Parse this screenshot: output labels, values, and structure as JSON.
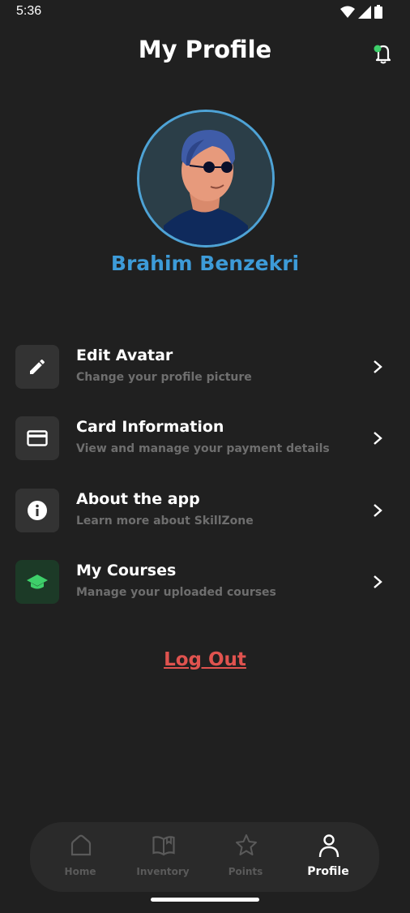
{
  "status_bar": {
    "time": "5:36"
  },
  "header": {
    "title": "My Profile",
    "bell_icon": "notification-bell-icon",
    "notification_dot_color": "#3ecf6a"
  },
  "profile": {
    "name": "Brahim Benzekri",
    "name_color": "#3d9bd8"
  },
  "menu": [
    {
      "icon": "pencil-icon",
      "title": "Edit Avatar",
      "subtitle": "Change your profile picture"
    },
    {
      "icon": "card-icon",
      "title": "Card Information",
      "subtitle": "View and manage your payment details"
    },
    {
      "icon": "info-icon",
      "title": "About the app",
      "subtitle": "Learn more about SkillZone"
    },
    {
      "icon": "graduation-cap-icon",
      "title": "My Courses",
      "subtitle": "Manage your uploaded courses"
    }
  ],
  "logout": {
    "label": "Log Out",
    "color": "#e0534f"
  },
  "bottom_nav": [
    {
      "icon": "home-icon",
      "label": "Home",
      "active": false
    },
    {
      "icon": "book-icon",
      "label": "Inventory",
      "active": false
    },
    {
      "icon": "star-icon",
      "label": "Points",
      "active": false
    },
    {
      "icon": "user-icon",
      "label": "Profile",
      "active": true
    }
  ]
}
